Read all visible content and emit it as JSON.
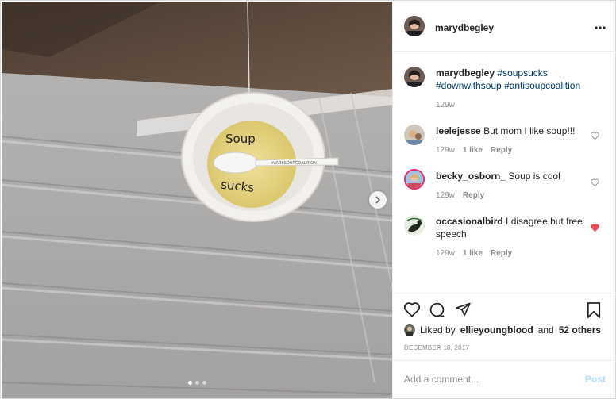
{
  "post": {
    "author": "marydbegley",
    "more_icon": "more-horizontal-icon",
    "caption_tags": [
      "#soupsucks",
      "#downwithsoup",
      "#antisoupcoalition"
    ],
    "caption_age": "129w"
  },
  "photo": {
    "plate_text_top": "Soup",
    "plate_text_bottom": "sucks",
    "spoon_text": "#ANTI SOUPCOALITION",
    "next_icon": "chevron-right-icon",
    "carousel_count": 3,
    "carousel_active": 1
  },
  "comments": [
    {
      "user": "leelejesse",
      "text": "But mom I like soup!!!",
      "age": "129w",
      "likes": "1 like",
      "reply": "Reply",
      "liked": false
    },
    {
      "user": "becky_osborn_",
      "text": "Soup is cool",
      "age": "129w",
      "likes": "",
      "reply": "Reply",
      "liked": false
    },
    {
      "user": "occasionalbird",
      "text": "I disagree but free speech",
      "age": "129w",
      "likes": "1 like",
      "reply": "Reply",
      "liked": true
    }
  ],
  "actions": {
    "liked_prefix": "Liked by",
    "liked_user": "ellieyoungblood",
    "liked_and": "and",
    "liked_others": "52 others",
    "date": "DECEMBER 18, 2017"
  },
  "add_comment": {
    "placeholder": "Add a comment...",
    "post_label": "Post"
  },
  "colors": {
    "link": "#00376b",
    "heart_red": "#ed4956",
    "muted": "#8e8e8e"
  }
}
